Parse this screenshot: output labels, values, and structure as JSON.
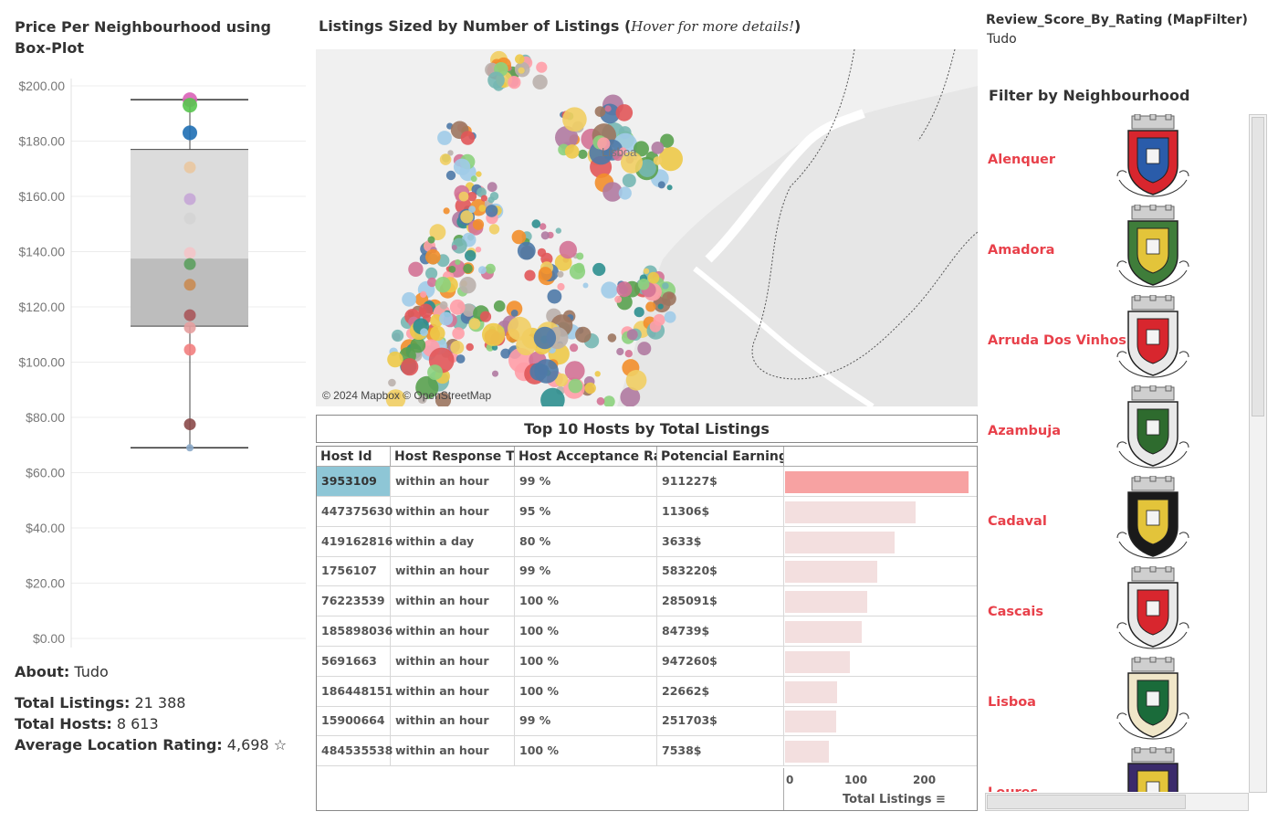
{
  "left": {
    "title": "Price Per Neighbourhood using Box-Plot",
    "about_label": "About:",
    "about_value": "Tudo",
    "stats": [
      {
        "label": "Total Listings:",
        "value": "21 388"
      },
      {
        "label": "Total Hosts:",
        "value": "8 613"
      },
      {
        "label": "Average Location Rating:",
        "value": "4,698 ☆"
      }
    ]
  },
  "chart_data": {
    "type": "box",
    "ylim": [
      0,
      200
    ],
    "y_ticks": [
      "$200.00",
      "$180.00",
      "$160.00",
      "$140.00",
      "$120.00",
      "$100.00",
      "$80.00",
      "$60.00",
      "$40.00",
      "$20.00",
      "$0.00"
    ],
    "y_tick_values": [
      200,
      180,
      160,
      140,
      120,
      100,
      80,
      60,
      40,
      20,
      0
    ],
    "box": {
      "min": 69,
      "q1": 113,
      "median": 137.5,
      "q3": 177,
      "max": 195
    },
    "points": [
      {
        "value": 195,
        "color": "#d962b7"
      },
      {
        "value": 193,
        "color": "#59c54f"
      },
      {
        "value": 183,
        "color": "#1f6fb4"
      },
      {
        "value": 170.5,
        "color": "#e9c7a0"
      },
      {
        "value": 159,
        "color": "#c5a6d6"
      },
      {
        "value": 152,
        "color": "#d4d4d4"
      },
      {
        "value": 139.5,
        "color": "#f3c4c8"
      },
      {
        "value": 135.5,
        "color": "#5c9e5e"
      },
      {
        "value": 128,
        "color": "#c98b52"
      },
      {
        "value": 117,
        "color": "#a8575a"
      },
      {
        "value": 112.5,
        "color": "#e69e9e"
      },
      {
        "value": 104.5,
        "color": "#f28080"
      },
      {
        "value": 77.5,
        "color": "#8b4a4a"
      },
      {
        "value": 69,
        "color": "#8aa8c8"
      }
    ]
  },
  "map": {
    "title": "Listings Sized by Number of Listings (",
    "title_hover": "Hover for more details!",
    "title_close": ")",
    "city_label": "Lisboa",
    "credit": "© 2024 Mapbox © OpenStreetMap"
  },
  "table": {
    "title": "Top 10 Hosts by Total Listings",
    "headers": [
      "Host Id",
      "Host Response Ti..",
      "Host Acceptance Ra..",
      "Potencial Earnings"
    ],
    "rows": [
      {
        "host_id": "3953109",
        "response": "within an hour",
        "acceptance": "99 %",
        "earnings": "911227$",
        "total_listings": 268
      },
      {
        "host_id": "447375630",
        "response": "within an hour",
        "acceptance": "95 %",
        "earnings": "11306$",
        "total_listings": 190
      },
      {
        "host_id": "419162816",
        "response": "within a day",
        "acceptance": "80 %",
        "earnings": "3633$",
        "total_listings": 160
      },
      {
        "host_id": "1756107",
        "response": "within an hour",
        "acceptance": "99 %",
        "earnings": "583220$",
        "total_listings": 134
      },
      {
        "host_id": "76223539",
        "response": "within an hour",
        "acceptance": "100 %",
        "earnings": "285091$",
        "total_listings": 120
      },
      {
        "host_id": "185898036",
        "response": "within an hour",
        "acceptance": "100 %",
        "earnings": "84739$",
        "total_listings": 112
      },
      {
        "host_id": "5691663",
        "response": "within an hour",
        "acceptance": "100 %",
        "earnings": "947260$",
        "total_listings": 94
      },
      {
        "host_id": "186448151",
        "response": "within an hour",
        "acceptance": "100 %",
        "earnings": "22662$",
        "total_listings": 76
      },
      {
        "host_id": "15900664",
        "response": "within an hour",
        "acceptance": "99 %",
        "earnings": "251703$",
        "total_listings": 74
      },
      {
        "host_id": "484535538",
        "response": "within an hour",
        "acceptance": "100 %",
        "earnings": "7538$",
        "total_listings": 64
      }
    ],
    "axis_ticks": [
      "0",
      "100",
      "200"
    ],
    "axis_tick_values": [
      0,
      100,
      200
    ],
    "axis_label": "Total Listings",
    "axis_max": 280
  },
  "filter": {
    "title": "Review_Score_By_Rating (MapFilter)",
    "value": "Tudo",
    "neighbourhood_title": "Filter by Neighbourhood",
    "neighbourhoods": [
      {
        "name": "Alenquer",
        "crest_color": "#d8262e",
        "crest_inner": "#2a5caa",
        "crest_text": "VILA DE ALENQUER"
      },
      {
        "name": "Amadora",
        "crest_color": "#3f7d3a",
        "crest_inner": "#e3c43a",
        "crest_text": "CIDADE DA AMADORA"
      },
      {
        "name": "Arruda Dos Vinhos",
        "crest_color": "#e9e9e9",
        "crest_inner": "#d8262e",
        "crest_text": "ARRUDA DOS VINHOS"
      },
      {
        "name": "Azambuja",
        "crest_color": "#e9e9e9",
        "crest_inner": "#2e6b2e",
        "crest_text": "VILA DE AZAMBUJA"
      },
      {
        "name": "Cadaval",
        "crest_color": "#1a1a1a",
        "crest_inner": "#e3c43a",
        "crest_text": "VILA DO CADAVAL"
      },
      {
        "name": "Cascais",
        "crest_color": "#e9e9e9",
        "crest_inner": "#d8262e",
        "crest_text": "VILA DE CASCAIS"
      },
      {
        "name": "Lisboa",
        "crest_color": "#f0e6c8",
        "crest_inner": "#1a6b3a",
        "crest_text": "CIDADE DE LISBOA"
      },
      {
        "name": "Loures",
        "crest_color": "#3b2b6b",
        "crest_inner": "#e3c43a",
        "crest_text": "LOURES"
      }
    ]
  }
}
